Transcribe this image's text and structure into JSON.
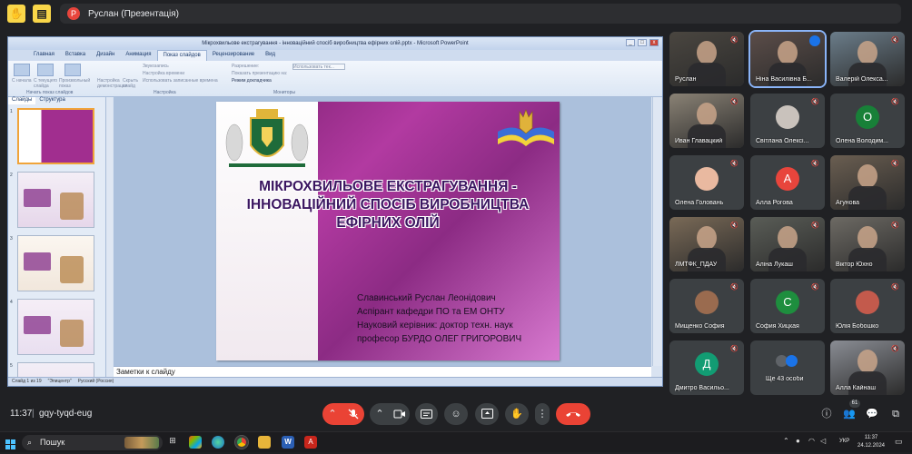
{
  "top": {
    "presenter_initial": "Р",
    "presenter_label": "Руслан (Презентація)"
  },
  "ppt": {
    "window_title": "Мікрохвильове екстрагування - інноваційний спосіб виробництва ефірних олій.pptx - Microsoft PowerPoint",
    "tabs": [
      "Главная",
      "Вставка",
      "Дизайн",
      "Анимация",
      "Показ слайдов",
      "Рецензирование",
      "Вид"
    ],
    "active_tab": "Показ слайдов",
    "ribbon": {
      "btn_from_start": "С начала",
      "btn_from_current": "С текущего слайда",
      "btn_custom_show": "Произвольный показ",
      "group_start": "Начать показ слайдов",
      "btn_setup": "Настройка демонстрации",
      "btn_hide": "Скрыть слайд",
      "opt_narration": "Звукозапись",
      "opt_rehearse": "Настройка времени",
      "opt_timing": "Использовать записанные времена",
      "group_setup": "Настройка",
      "opt_resolution": "Разрешение:",
      "opt_show_on": "Показать презентацию на:",
      "opt_presenter": "Режим докладчика",
      "group_monitors": "Мониторы",
      "dropdown_value": "Использовать тек..."
    },
    "side_tabs": [
      "Слайды",
      "Структура"
    ],
    "thumb_numbers": [
      "1",
      "2",
      "3",
      "4",
      "5"
    ],
    "slide": {
      "title_lines": [
        "МІКРОХВИЛЬОВЕ ЕКСТРАГУВАННЯ -",
        "ІННОВАЦІЙНИЙ СПОСІБ ВИРОБНИЦТВА",
        "ЕФІРНИХ ОЛІЙ"
      ],
      "author_lines": [
        "Славинський Руслан Леонідович",
        "Аспірант кафедри ПО та ЕМ ОНТУ",
        "Науковий керівник: доктор техн. наук",
        "професор БУРДО ОЛЕГ ГРИГОРОВИЧ"
      ]
    },
    "notes_placeholder": "Заметки к слайду",
    "status": {
      "slide_info": "Слайд 1 из 19",
      "theme": "\"Эпицентр\"",
      "language": "Русский (Россия)"
    }
  },
  "participants": [
    {
      "name": "Руслан",
      "kind": "photo",
      "color": "#4a4640"
    },
    {
      "name": "Ніна Василівна Б...",
      "kind": "photo",
      "color": "#5b4d49",
      "speaking": true
    },
    {
      "name": "Валерій Олекса...",
      "kind": "photo",
      "color": "#6b7d8a"
    },
    {
      "name": "Иван Главацкий",
      "kind": "photo",
      "color": "#8a8275"
    },
    {
      "name": "Світлана Олексі...",
      "kind": "avatar",
      "color": "#c9c2bc"
    },
    {
      "name": "Олена Володим...",
      "kind": "letter",
      "letter": "O",
      "color": "#188038"
    },
    {
      "name": "Олена Головань",
      "kind": "avatar",
      "color": "#e9b9a0"
    },
    {
      "name": "Алла Рогова",
      "kind": "letter",
      "letter": "А",
      "color": "#e8453c"
    },
    {
      "name": "Агунова",
      "kind": "photo",
      "color": "#6a5e51"
    },
    {
      "name": "ЛМТФК_ПДАУ",
      "kind": "photo",
      "color": "#7a6a57"
    },
    {
      "name": "Аліна Лукаш",
      "kind": "photo",
      "color": "#5a5d57"
    },
    {
      "name": "Віктор Юхно",
      "kind": "photo",
      "color": "#6d6a64"
    },
    {
      "name": "Мищенко София",
      "kind": "avatar",
      "color": "#9a6b4f"
    },
    {
      "name": "София Хицкая",
      "kind": "letter",
      "letter": "С",
      "color": "#1e8e3e"
    },
    {
      "name": "Юлія Бобошко",
      "kind": "avatar",
      "color": "#c35a4c"
    },
    {
      "name": "Дмитро Васильо...",
      "kind": "letter",
      "letter": "Д",
      "color": "#129c73"
    },
    {
      "name": "Ще 43 особи",
      "kind": "more",
      "color": "#3c4043"
    },
    {
      "name": "Алла Кайнаш",
      "kind": "photo",
      "color": "#8a8d94"
    }
  ],
  "call": {
    "time": "11:37",
    "meeting_code": "gqy-tyqd-eug",
    "people_count": "61"
  },
  "taskbar": {
    "search_placeholder": "Пошук",
    "language": "УКР",
    "clock_time": "11:37",
    "clock_date": "24.12.2024"
  }
}
